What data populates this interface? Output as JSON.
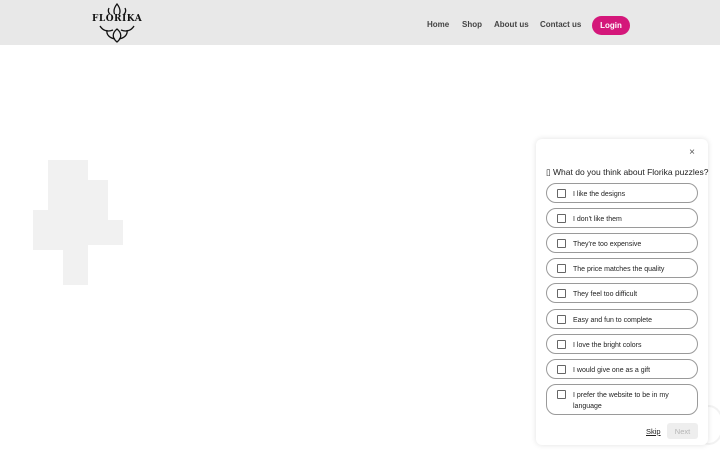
{
  "brand": {
    "logo_text": "FLORIKA",
    "accent": "#d4177a"
  },
  "nav": {
    "links": [
      "Home",
      "Shop",
      "About us",
      "Contact us"
    ],
    "login_label": "Login"
  },
  "survey": {
    "close_glyph": "×",
    "question": "▯ What do you think about Florika puzzles?",
    "options": [
      "I like the designs",
      "I don't like them",
      "They're too expensive",
      "The price matches the quality",
      "They feel too difficult",
      "Easy and fun to complete",
      "I love the bright colors",
      "I would give one as a gift",
      "I prefer the website to be in my language"
    ],
    "skip_label": "Skip",
    "next_label": "Next"
  }
}
